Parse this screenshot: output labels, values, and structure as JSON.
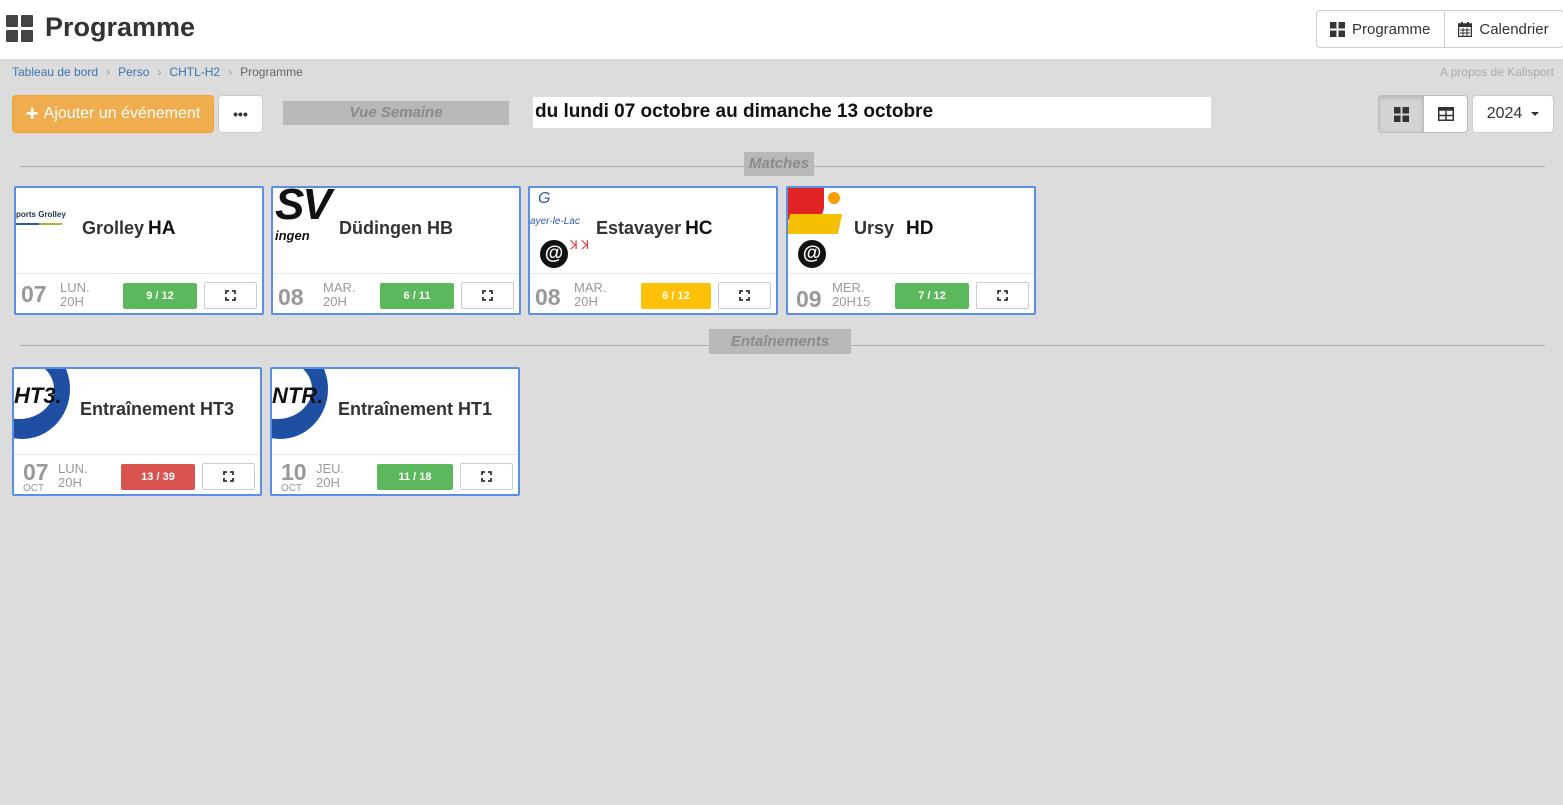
{
  "header": {
    "title": "Programme",
    "buttons": {
      "programme": "Programme",
      "calendar": "Calendrier"
    }
  },
  "breadcrumb": {
    "items": [
      "Tableau de bord",
      "Perso",
      "CHTL-H2",
      "Programme"
    ],
    "about": "A propos de Kalisport"
  },
  "toolbar": {
    "add_event": "Ajouter un événement",
    "more": "•••",
    "view_label": "Vue Semaine",
    "date_range": "du lundi 07 octobre au dimanche 13 octobre",
    "year": "2024"
  },
  "sections": {
    "matches": "Matches",
    "trainings": "Entaînements"
  },
  "matches": [
    {
      "name": "Grolley",
      "team": "HA",
      "day": "07",
      "weekday": "LUN.",
      "time": "20H",
      "count": "9 / 12",
      "status_color": "#5cb85c",
      "logo_text": "ports Grolley",
      "away": false
    },
    {
      "name": "Düdingen HB",
      "team": "",
      "day": "08",
      "weekday": "MAR.",
      "time": "20H",
      "count": "6 / 11",
      "status_color": "#5cb85c",
      "logo_text": "SV",
      "logo_sub": "ingen",
      "away": false
    },
    {
      "name": "Estavayer",
      "team": "HC",
      "day": "08",
      "weekday": "MAR.",
      "time": "20H",
      "count": "6 / 12",
      "status_color": "#ffc107",
      "logo_text": "G",
      "logo_sub": "ayer-le-Lac",
      "away": true
    },
    {
      "name": "Ursy",
      "team": "HD",
      "day": "09",
      "weekday": "MER.",
      "time": "20H15",
      "count": "7 / 12",
      "status_color": "#5cb85c",
      "away": true
    }
  ],
  "trainings": [
    {
      "name": "Entraînement HT3",
      "day": "07",
      "month": "OCT",
      "weekday": "LUN.",
      "time": "20H",
      "count": "13 / 39",
      "status_color": "#d9534f",
      "logo_text": "HT3."
    },
    {
      "name": "Entraînement HT1",
      "day": "10",
      "month": "OCT",
      "weekday": "JEU.",
      "time": "20H",
      "count": "11 / 18",
      "status_color": "#5cb85c",
      "logo_text": "NTR."
    }
  ],
  "badge": "@"
}
